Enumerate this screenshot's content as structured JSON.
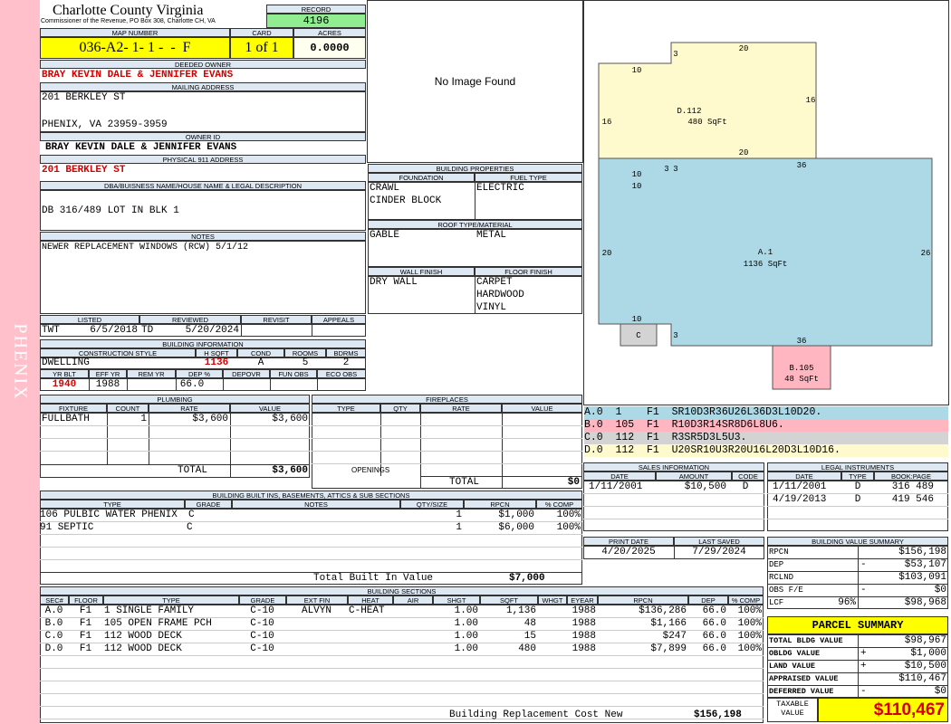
{
  "county": {
    "name": "Charlotte County Virginia",
    "address": "Commissioner of the Revenue, PO Box 308, Charlotte CH, VA"
  },
  "side_label": "PHENIX",
  "record": {
    "label": "RECORD",
    "value": "4196"
  },
  "map": {
    "label": "MAP NUMBER",
    "value": "036-A2- 1- 1 -  -  F",
    "card_label": "CARD",
    "card_value": "1 of 1",
    "acres_label": "ACRES",
    "acres_value": "0.0000"
  },
  "owner": {
    "label": "DEEDED OWNER",
    "value": "BRAY KEVIN DALE & JENNIFER EVANS"
  },
  "mailing": {
    "label": "MAILING ADDRESS",
    "line1": "201 BERKLEY ST",
    "line2": "PHENIX, VA 23959-3959"
  },
  "owner_id": {
    "label": "OWNER ID",
    "value": "BRAY KEVIN DALE & JENNIFER EVANS"
  },
  "physical": {
    "label": "PHYSICAL 911 ADDRESS",
    "value": "201 BERKLEY ST"
  },
  "legal_desc": {
    "label": "DBA/BUISNESS NAME/HOUSE NAME & LEGAL DESCRIPTION",
    "value": "DB 316/489 LOT IN BLK 1"
  },
  "notes": {
    "label": "NOTES",
    "value": "NEWER REPLACEMENT WINDOWS (RCW) 5/1/12"
  },
  "image_placeholder": "No Image Found",
  "listed": {
    "listed_label": "LISTED",
    "reviewed_label": "REVIEWED",
    "revisit_label": "REVISIT",
    "appeals_label": "APPEALS",
    "listed_by": "TWT",
    "listed_date": "6/5/2018",
    "reviewed_by": "TD",
    "reviewed_date": "5/20/2024"
  },
  "building_info": {
    "label": "BUILDING INFORMATION",
    "h": [
      "CONSTRUCTION STYLE",
      "H SQFT",
      "COND",
      "ROOMS",
      "BDRMS"
    ],
    "v": [
      "DWELLING",
      "1136",
      "A",
      "5",
      "2"
    ],
    "h2": [
      "YR BLT",
      "EFF YR",
      "REM YR",
      "DEP %",
      "DEPOVR",
      "FUN OBS",
      "ECO OBS"
    ],
    "v2": [
      "1940",
      "1988",
      "",
      "66.0",
      "",
      "",
      ""
    ]
  },
  "building_props": {
    "label": "BUILDING PROPERTIES",
    "foundation_label": "FOUNDATION",
    "fuel_label": "FUEL TYPE",
    "foundation_1": "CRAWL",
    "foundation_2": "CINDER BLOCK",
    "fuel": "ELECTRIC",
    "roof_label": "ROOF TYPE/MATERIAL",
    "roof_type": "GABLE",
    "roof_material": "METAL",
    "wall_label": "WALL FINISH",
    "floor_label": "FLOOR FINISH",
    "wall": "DRY WALL",
    "floor_1": "CARPET",
    "floor_2": "HARDWOOD",
    "floor_3": "VINYL"
  },
  "sketch": {
    "d_label": "D.112",
    "d_area": "480 SqFt",
    "a_label": "A.1",
    "a_area": "1136 SqFt",
    "b_label": "B.105",
    "b_area": "48 SqFt",
    "c_label": "C",
    "dims": {
      "d_top": "20",
      "d_left_top": "10",
      "d_jog": "3",
      "d_right": "16",
      "d_left": "16",
      "d_bottom": "20",
      "d_bl": "10",
      "d_b3": "3",
      "d_b3b": "3",
      "a_top": "36",
      "a_left_top": "10",
      "a_left": "20",
      "a_right": "26",
      "a_bottom": "36",
      "a_bl": "10",
      "a_b3": "3"
    }
  },
  "sketch_legend": [
    {
      "text": "A.0  1    F1  SR10D3R36U26L36D3L10D20.",
      "color": "#add8e6"
    },
    {
      "text": "B.0  105  F1  R10D3R14SR8D6L8U6.",
      "color": "#ffb6c1"
    },
    {
      "text": "C.0  112  F1  R3SR5D3L5U3.",
      "color": "#d3d3d3"
    },
    {
      "text": "D.0  112  F1  U20SR10U3R20U16L20D3L10D16.",
      "color": "#fffacd"
    }
  ],
  "plumbing": {
    "label": "PLUMBING",
    "headers": [
      "FIXTURE",
      "COUNT",
      "RATE",
      "VALUE"
    ],
    "rows": [
      {
        "fixture": "FULLBATH",
        "count": "1",
        "rate": "$3,600",
        "value": "$3,600"
      }
    ],
    "total_label": "TOTAL",
    "total": "$3,600"
  },
  "fireplaces": {
    "label": "FIREPLACES",
    "headers": [
      "TYPE",
      "QTY",
      "RATE",
      "VALUE"
    ],
    "openings_label": "OPENINGS",
    "total_label": "TOTAL",
    "total": "$0"
  },
  "built_ins": {
    "label": "BUILDING BUILT INS, BASEMENTS, ATTICS & SUB SECTIONS",
    "headers": [
      "TYPE",
      "GRADE",
      "NOTES",
      "QTY/SIZE",
      "RPCN",
      "% COMP"
    ],
    "rows": [
      {
        "type": "106 PULBIC WATER PHENIX",
        "grade": "C",
        "notes": "",
        "qty": "1",
        "rpcn": "$1,000",
        "comp": "100%"
      },
      {
        "type": "91 SEPTIC",
        "grade": "C",
        "notes": "",
        "qty": "1",
        "rpcn": "$6,000",
        "comp": "100%"
      }
    ],
    "total_label": "Total Built In Value",
    "total": "$7,000"
  },
  "sales": {
    "label": "SALES INFORMATION",
    "headers": [
      "DATE",
      "AMOUNT",
      "CODE"
    ],
    "rows": [
      {
        "date": "1/11/2001",
        "amount": "$10,500",
        "code": "D"
      }
    ]
  },
  "legal_instruments": {
    "label": "LEGAL INSTRUMENTS",
    "headers": [
      "DATE",
      "TYPE",
      "BOOK:PAGE"
    ],
    "rows": [
      {
        "date": "1/11/2001",
        "type": "D",
        "book": "316 489"
      },
      {
        "date": "4/19/2013",
        "type": "D",
        "book": "419 546"
      }
    ]
  },
  "print_info": {
    "print_label": "PRINT DATE",
    "saved_label": "LAST SAVED",
    "print_date": "4/20/2025",
    "saved_date": "7/29/2024"
  },
  "value_summary": {
    "label": "BUILDING VALUE SUMMARY",
    "rows": [
      {
        "label": "RPCN",
        "sign": "",
        "pct": "",
        "value": "$156,198"
      },
      {
        "label": "DEP",
        "sign": "-",
        "pct": "",
        "value": "$53,107"
      },
      {
        "label": "RCLND",
        "sign": "",
        "pct": "",
        "value": "$103,091"
      },
      {
        "label": "OBS F/E",
        "sign": "-",
        "pct": "",
        "value": "$0"
      },
      {
        "label": "LCF",
        "sign": "",
        "pct": "96%",
        "value": "$98,968"
      }
    ]
  },
  "parcel": {
    "label": "PARCEL SUMMARY",
    "rows": [
      {
        "label": "TOTAL BLDG VALUE",
        "sign": "",
        "value": "$98,967"
      },
      {
        "label": "OBLDG VALUE",
        "sign": "+",
        "value": "$1,000"
      },
      {
        "label": "LAND VALUE",
        "sign": "+",
        "value": "$10,500"
      },
      {
        "label": "APPRAISED VALUE",
        "sign": "",
        "value": "$110,467"
      },
      {
        "label": "DEFERRED VALUE",
        "sign": "-",
        "value": "$0"
      }
    ],
    "taxable_label_1": "TAXABLE",
    "taxable_label_2": "VALUE",
    "taxable_value": "$110,467"
  },
  "sections": {
    "label": "BUILDING SECTIONS",
    "headers": [
      "SEC#",
      "FLOOR",
      "TYPE",
      "GRADE",
      "EXT FIN",
      "HEAT",
      "AIR",
      "SHGT",
      "SQFT",
      "WHGT",
      "EYEAR",
      "RPCN",
      "DEP",
      "% COMP"
    ],
    "rows": [
      [
        "A.0",
        "F1",
        "1 SINGLE FAMILY",
        "C-10",
        "ALVYN",
        "C-HEAT",
        "",
        "1.00",
        "1,136",
        "",
        "1988",
        "$136,286",
        "66.0",
        "100%"
      ],
      [
        "B.0",
        "F1",
        "105 OPEN FRAME PCH",
        "C-10",
        "",
        "",
        "",
        "1.00",
        "48",
        "",
        "1988",
        "$1,166",
        "66.0",
        "100%"
      ],
      [
        "C.0",
        "F1",
        "112 WOOD DECK",
        "C-10",
        "",
        "",
        "",
        "1.00",
        "15",
        "",
        "1988",
        "$247",
        "66.0",
        "100%"
      ],
      [
        "D.0",
        "F1",
        "112 WOOD DECK",
        "C-10",
        "",
        "",
        "",
        "1.00",
        "480",
        "",
        "1988",
        "$7,899",
        "66.0",
        "100%"
      ]
    ],
    "replacement_label": "Building Replacement Cost New",
    "replacement_value": "$156,198"
  }
}
